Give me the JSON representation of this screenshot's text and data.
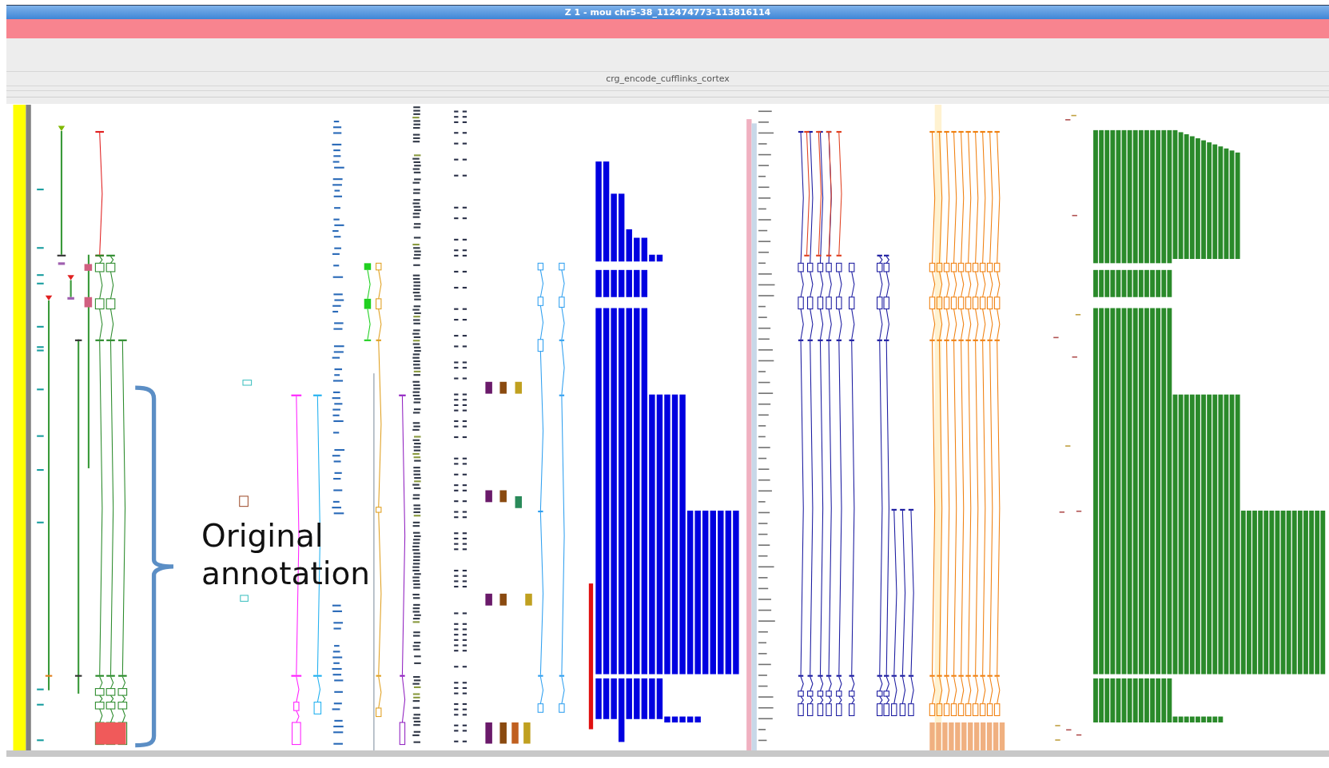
{
  "window": {
    "title": "Z 1 - mou chr5-38_112474773-113816114"
  },
  "column_header": {
    "label": "crg_encode_cufflinks_cortex"
  },
  "annotation": {
    "text": "Original annotation"
  }
}
